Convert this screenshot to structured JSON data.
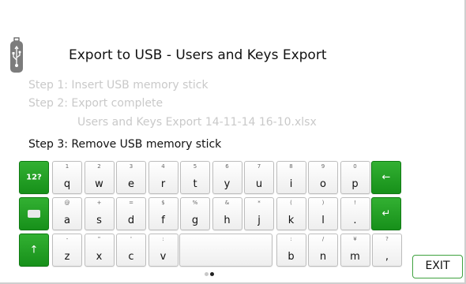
{
  "header": {
    "title": "Export to USB - Users and Keys Export"
  },
  "steps": {
    "step1": "Step 1: Insert USB memory stick",
    "step2": "Step 2: Export complete",
    "filename": "Users and Keys Export 14-11-14 16-10.xlsx",
    "step3": "Step 3: Remove USB memory stick"
  },
  "keyboard": {
    "mode_label": "12?",
    "row1": [
      {
        "pri": "q",
        "sec": "1"
      },
      {
        "pri": "w",
        "sec": "2"
      },
      {
        "pri": "e",
        "sec": "3"
      },
      {
        "pri": "r",
        "sec": "4"
      },
      {
        "pri": "t",
        "sec": "5"
      },
      {
        "pri": "y",
        "sec": "6"
      },
      {
        "pri": "u",
        "sec": "7"
      },
      {
        "pri": "i",
        "sec": "8"
      },
      {
        "pri": "o",
        "sec": "9"
      },
      {
        "pri": "p",
        "sec": "0"
      }
    ],
    "row2": [
      {
        "pri": "a",
        "sec": "@"
      },
      {
        "pri": "s",
        "sec": "+"
      },
      {
        "pri": "d",
        "sec": "="
      },
      {
        "pri": "f",
        "sec": "$"
      },
      {
        "pri": "g",
        "sec": "%"
      },
      {
        "pri": "h",
        "sec": "&"
      },
      {
        "pri": "j",
        "sec": "*"
      },
      {
        "pri": "k",
        "sec": "("
      },
      {
        "pri": "l",
        "sec": ")"
      },
      {
        "pri": ".",
        "sec": "!"
      }
    ],
    "row3": [
      {
        "pri": "z",
        "sec": "-"
      },
      {
        "pri": "x",
        "sec": "\""
      },
      {
        "pri": "c",
        "sec": "'"
      },
      {
        "pri": "v",
        "sec": ":"
      },
      {
        "pri": "b",
        "sec": ":"
      },
      {
        "pri": "n",
        "sec": "/"
      },
      {
        "pri": "m",
        "sec": "¥"
      },
      {
        "pri": ",",
        "sec": "?"
      }
    ],
    "backspace_glyph": "←",
    "enter_glyph": "↵",
    "shift_glyph": "↑"
  },
  "footer": {
    "exit_label": "EXIT"
  },
  "pager": {
    "pages": 2,
    "current": 2
  },
  "colors": {
    "accent_green": "#1a961d",
    "muted_text": "#c9c9c9"
  }
}
